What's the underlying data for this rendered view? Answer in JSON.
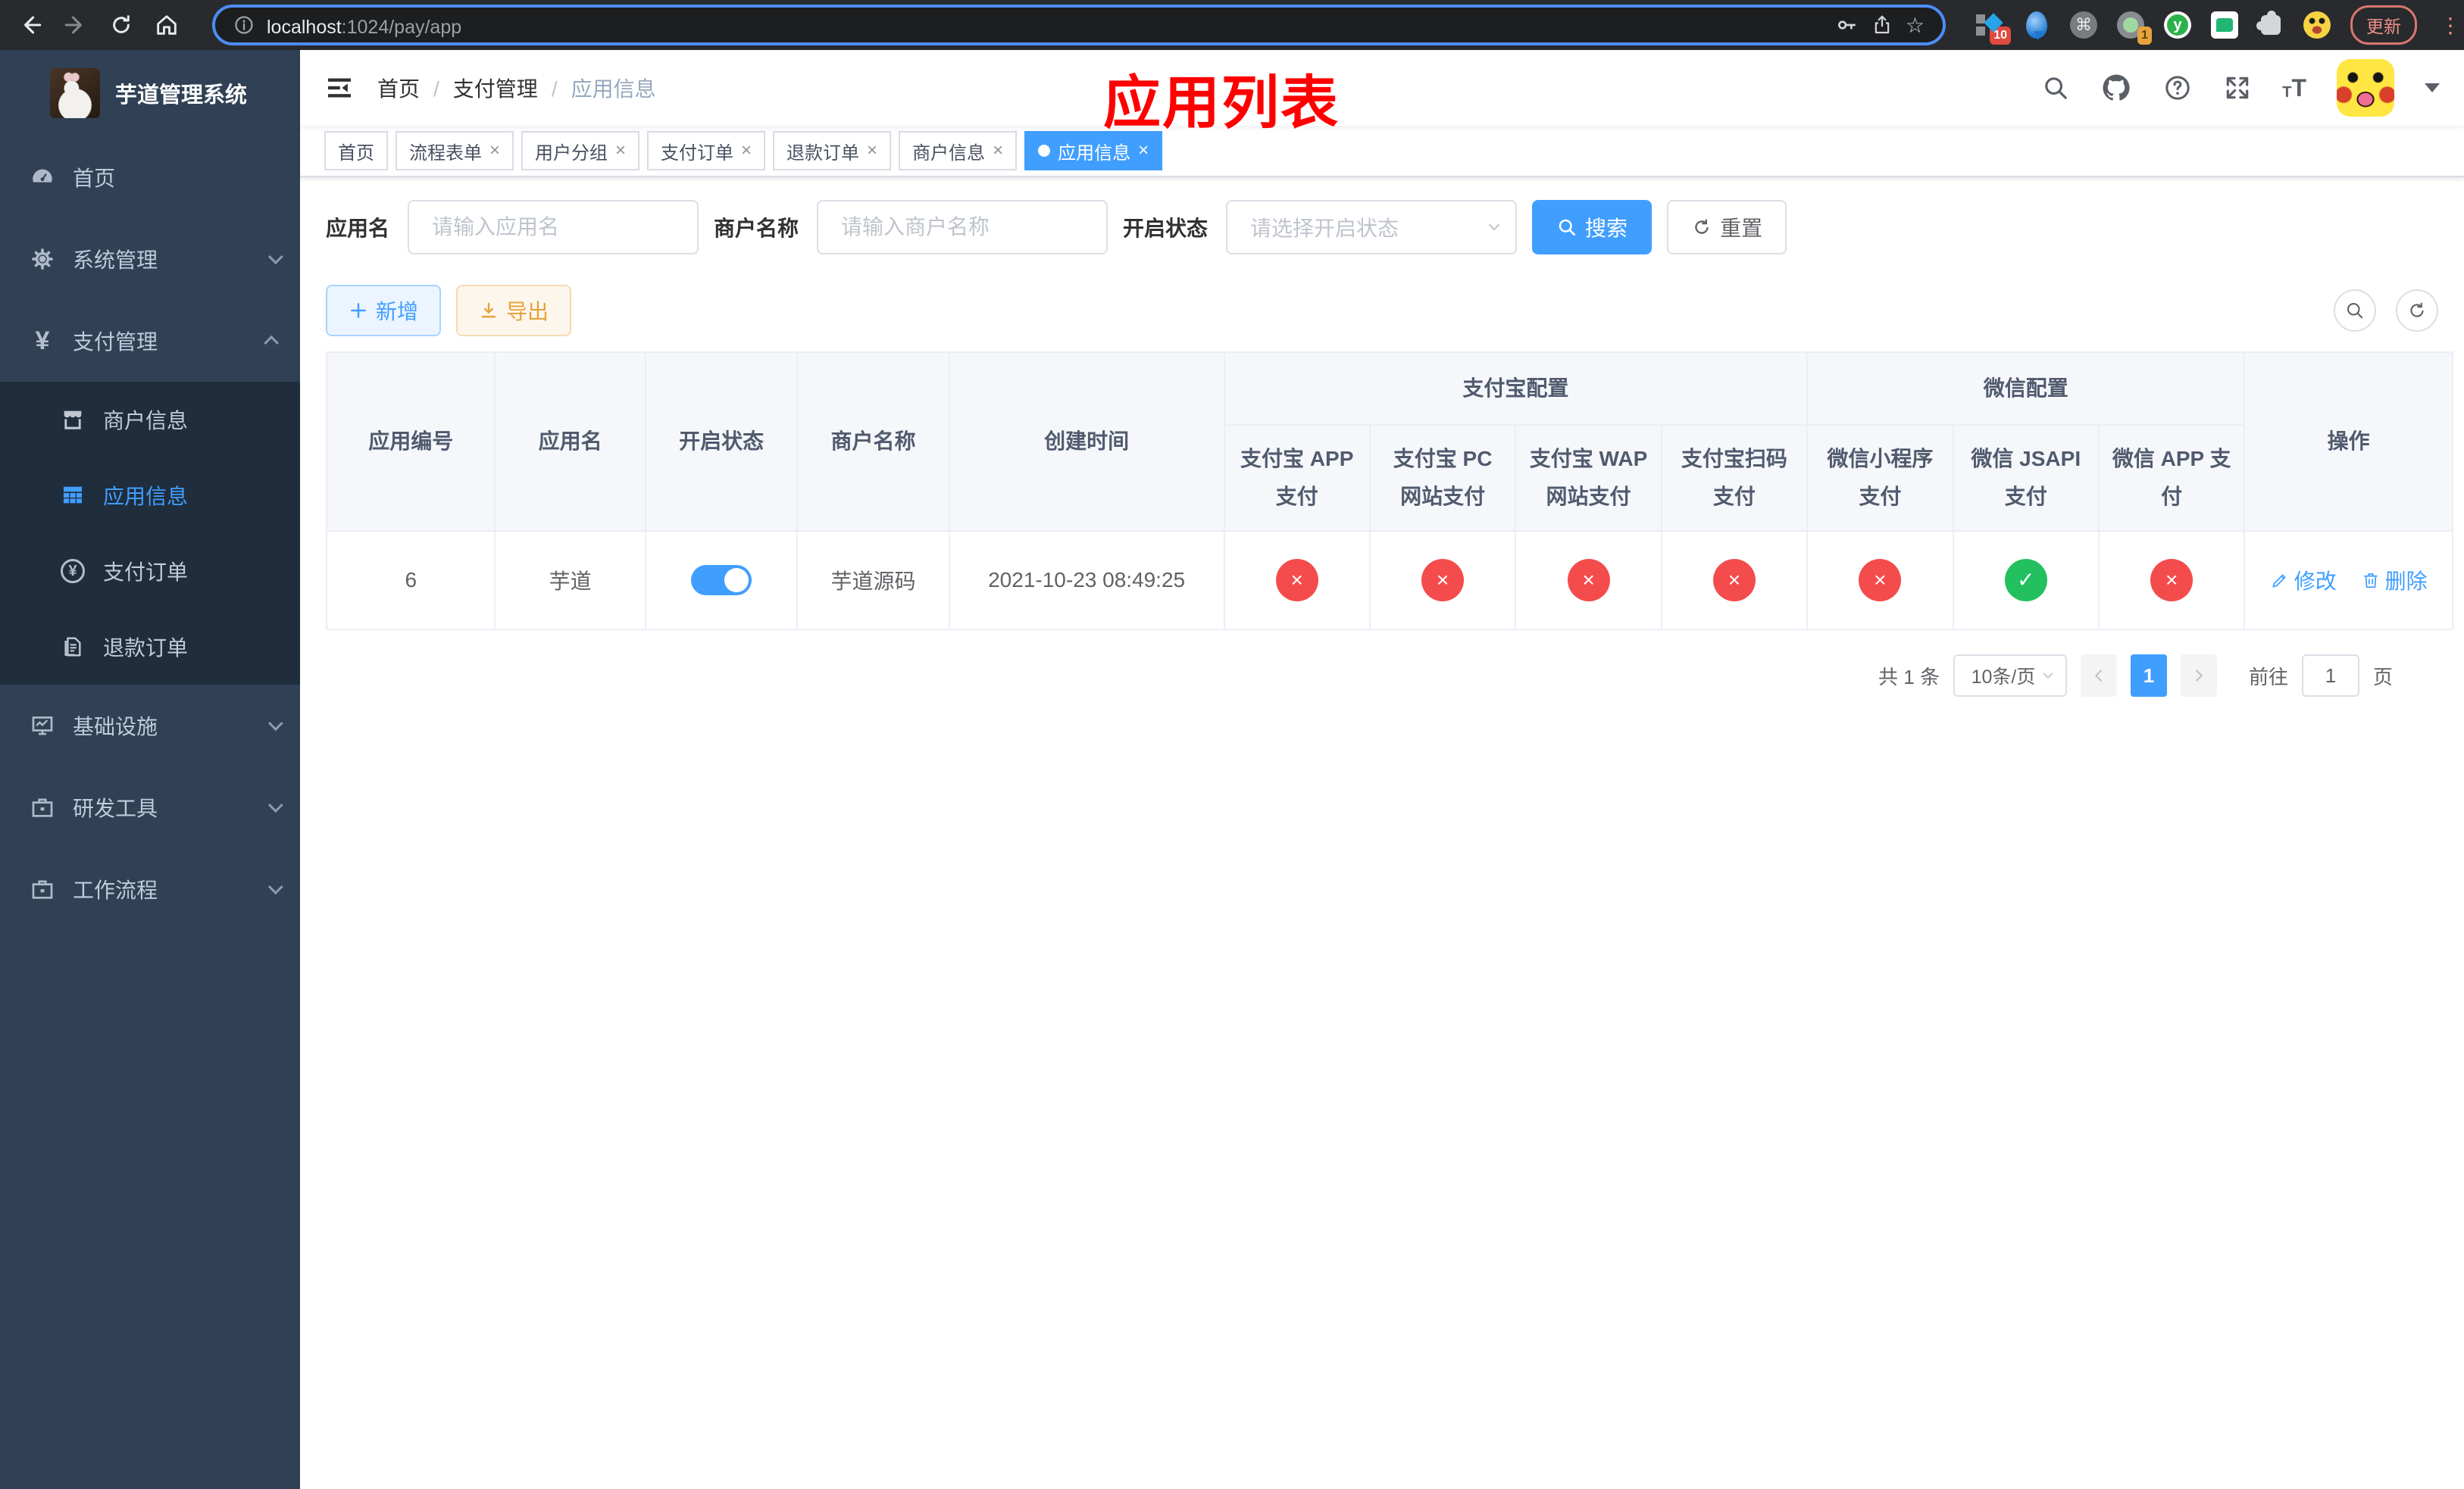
{
  "browser": {
    "url": {
      "host": "localhost",
      "path": ":1024/pay/app"
    },
    "badges": {
      "kit": "10",
      "recorder": "1"
    },
    "update_label": "更新"
  },
  "sidebar": {
    "title": "芋道管理系统",
    "items": [
      {
        "label": "首页",
        "icon": "dashboard-icon"
      },
      {
        "label": "系统管理",
        "icon": "gear-icon"
      },
      {
        "label": "支付管理",
        "icon": "yen-icon",
        "expanded": true,
        "children": [
          {
            "label": "商户信息",
            "icon": "shop-icon"
          },
          {
            "label": "应用信息",
            "icon": "grid-icon",
            "active": true
          },
          {
            "label": "支付订单",
            "icon": "coin-icon"
          },
          {
            "label": "退款订单",
            "icon": "document-icon"
          }
        ]
      },
      {
        "label": "基础设施",
        "icon": "monitor-icon"
      },
      {
        "label": "研发工具",
        "icon": "toolbox-icon"
      },
      {
        "label": "工作流程",
        "icon": "toolbox-icon"
      }
    ]
  },
  "navbar": {
    "breadcrumb": [
      "首页",
      "支付管理",
      "应用信息"
    ],
    "annotation": "应用列表",
    "icons": [
      "search-icon",
      "github-icon",
      "help-icon",
      "fullscreen-icon",
      "font-size-icon"
    ]
  },
  "tabs": [
    {
      "label": "首页",
      "closable": false,
      "active": false
    },
    {
      "label": "流程表单",
      "closable": true,
      "active": false
    },
    {
      "label": "用户分组",
      "closable": true,
      "active": false
    },
    {
      "label": "支付订单",
      "closable": true,
      "active": false
    },
    {
      "label": "退款订单",
      "closable": true,
      "active": false
    },
    {
      "label": "商户信息",
      "closable": true,
      "active": false
    },
    {
      "label": "应用信息",
      "closable": true,
      "active": true
    }
  ],
  "filters": {
    "app_name": {
      "label": "应用名",
      "placeholder": "请输入应用名",
      "value": ""
    },
    "merchant_name": {
      "label": "商户名称",
      "placeholder": "请输入商户名称",
      "value": ""
    },
    "status": {
      "label": "开启状态",
      "placeholder": "请选择开启状态",
      "value": ""
    },
    "search_label": "搜索",
    "reset_label": "重置"
  },
  "toolbar": {
    "add_label": "新增",
    "export_label": "导出"
  },
  "table": {
    "columns": [
      "应用编号",
      "应用名",
      "开启状态",
      "商户名称",
      "创建时间"
    ],
    "groups": [
      {
        "label": "支付宝配置",
        "children": [
          "支付宝 APP 支付",
          "支付宝 PC 网站支付",
          "支付宝 WAP 网站支付",
          "支付宝扫码支付"
        ]
      },
      {
        "label": "微信配置",
        "children": [
          "微信小程序支付",
          "微信 JSAPI 支付",
          "微信 APP 支付"
        ]
      }
    ],
    "ops_label": "操作",
    "rows": [
      {
        "id": "6",
        "name": "芋道",
        "enabled": true,
        "merchant": "芋道源码",
        "created": "2021-10-23 08:49:25",
        "channels": [
          false,
          false,
          false,
          false,
          false,
          true,
          false
        ],
        "ops": [
          "修改",
          "删除"
        ]
      }
    ]
  },
  "pagination": {
    "total": "共 1 条",
    "page_size": "10条/页",
    "current": "1",
    "goto_label": "前往",
    "goto_value": "1",
    "page_label": "页"
  },
  "colors": {
    "accent": "#409eff",
    "danger": "#f44c4c",
    "success": "#22c05f",
    "sidebar_bg": "#304156",
    "submenu_bg": "#1f2d3d",
    "annotation_red": "#fe0000"
  }
}
